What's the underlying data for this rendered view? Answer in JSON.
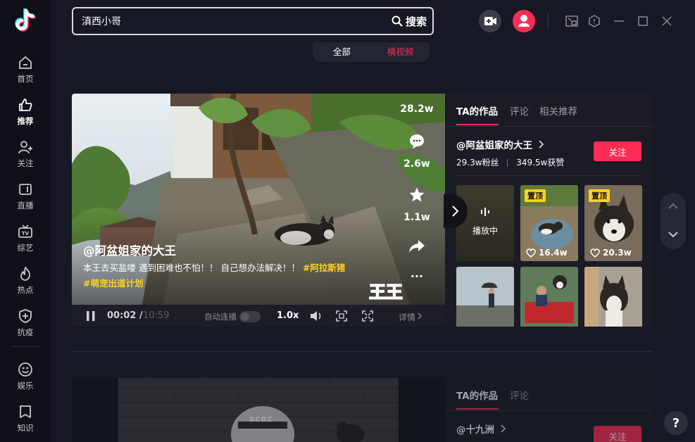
{
  "search": {
    "value": "滇西小哥",
    "button_label": "搜索"
  },
  "tabs": [
    {
      "label": "全部"
    },
    {
      "label": "横视频"
    }
  ],
  "sidebar": {
    "items": [
      {
        "label": "首页"
      },
      {
        "label": "推荐"
      },
      {
        "label": "关注"
      },
      {
        "label": "直播"
      },
      {
        "label": "综艺"
      },
      {
        "label": "热点"
      },
      {
        "label": "抗疫"
      },
      {
        "label": "娱乐"
      },
      {
        "label": "知识"
      }
    ]
  },
  "video": {
    "likes": "28.2w",
    "comments": "2.6w",
    "favorites": "1.1w",
    "author_handle": "@阿盆姐家的大王",
    "description": "本王去买盐喽 遇到困难也不怕！！ 自己想办法解决！！",
    "hashtags": [
      "#阿拉斯猪",
      "#萌宠出道计划"
    ],
    "watermark": "王王",
    "more": "···",
    "controls": {
      "time_current": "00:02 /",
      "time_total": "10:59",
      "autoplay_label": "自动连播",
      "speed": "1.0x",
      "details_label": "详情"
    }
  },
  "panel": {
    "tabs": [
      {
        "label": "TA的作品"
      },
      {
        "label": "评论"
      },
      {
        "label": "相关推荐"
      }
    ],
    "author_name": "@阿盆姐家的大王",
    "followers": "29.3w粉丝",
    "total_likes": "349.5w获赞",
    "follow_label": "关注",
    "thumbs": [
      {
        "playing_label": "播放中"
      },
      {
        "pin": "置顶",
        "likes": "16.4w"
      },
      {
        "pin": "置顶",
        "likes": "20.3w"
      },
      {},
      {},
      {}
    ]
  },
  "card2": {
    "tabs": [
      {
        "label": "TA的作品"
      },
      {
        "label": "评论"
      }
    ],
    "author_name": "@十九洲",
    "follow_label": "关注",
    "helmet_text": "SCBZ"
  },
  "help_label": "?",
  "colors": {
    "accent": "#fe2c55",
    "hashtag": "#ffd21d",
    "bg": "#161823"
  }
}
